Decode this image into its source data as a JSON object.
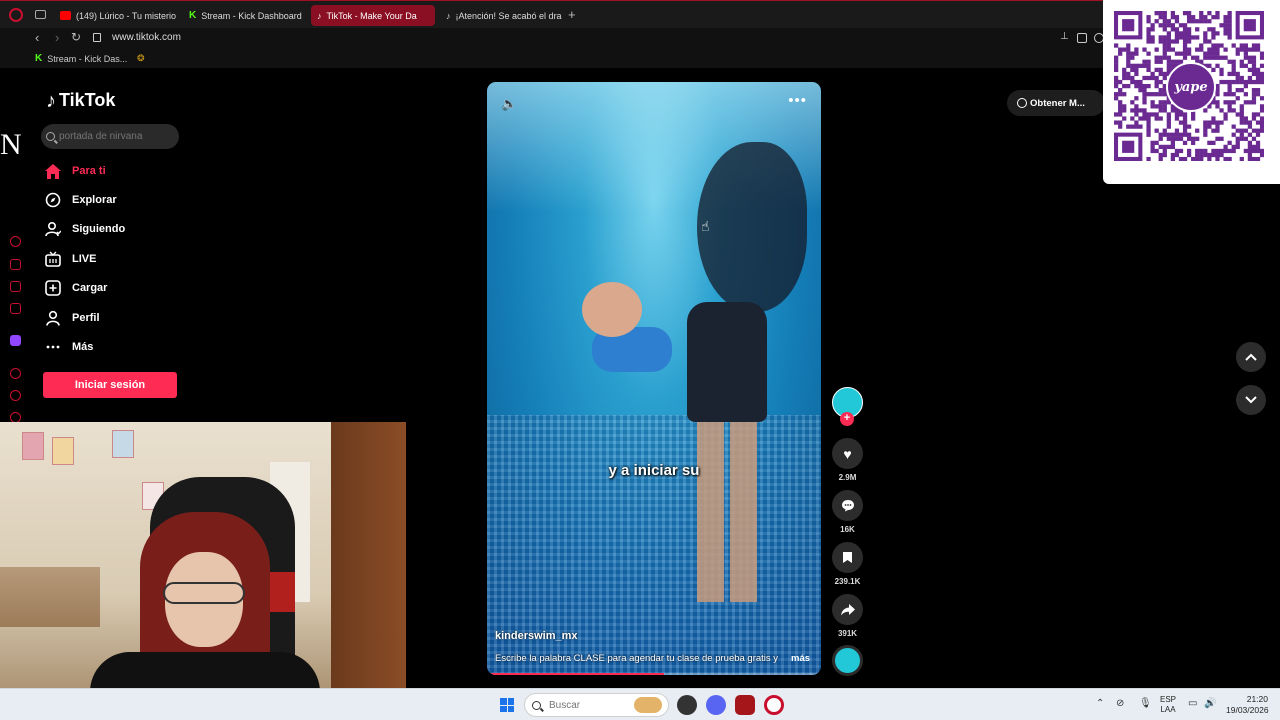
{
  "browser": {
    "tabs": [
      {
        "label": "(149) Lúrico - Tu misterios",
        "favicon_color": "#ff0000"
      },
      {
        "label": "Stream - Kick Dashboard",
        "favicon_color": "#53fc18"
      },
      {
        "label": "TikTok - Make Your Da",
        "favicon_color": "#ffffff"
      },
      {
        "label": "¡Atención! Se acabó el dra",
        "favicon_color": "#ffffff"
      }
    ],
    "active_tab_index": 2,
    "url": "www.tiktok.com",
    "bookmarks": [
      {
        "label": "Stream - Kick Das..."
      }
    ]
  },
  "tiktok": {
    "logo_text": "TikTok",
    "search": {
      "placeholder": "portada de nirvana"
    },
    "nav": [
      {
        "label": "Para ti",
        "icon": "home-icon",
        "active": true
      },
      {
        "label": "Explorar",
        "icon": "compass-icon",
        "active": false
      },
      {
        "label": "Siguiendo",
        "icon": "user-follow-icon",
        "active": false
      },
      {
        "label": "LIVE",
        "icon": "live-tv-icon",
        "active": false
      },
      {
        "label": "Cargar",
        "icon": "upload-plus-icon",
        "active": false
      },
      {
        "label": "Perfil",
        "icon": "profile-icon",
        "active": false
      },
      {
        "label": "Más",
        "icon": "more-dots-icon",
        "active": false
      }
    ],
    "login_label": "Iniciar sesión",
    "get_app_label": "Obtener M...",
    "accent_color": "#fe2c55"
  },
  "video": {
    "subtitle": "y a iniciar su",
    "author": "kinderswim_mx",
    "description": "Escribe la palabra CLASE para agendar tu clase de prueba gratis y",
    "more_label": "más",
    "progress": 0.53
  },
  "actions": {
    "likes": "2.9M",
    "comments": "16K",
    "saves": "239.1K",
    "shares": "391K"
  },
  "overlay": {
    "side_letter": "N",
    "qr_badge_text": "yape",
    "qr_badge_color": "#6b2a92"
  },
  "taskbar": {
    "search_label": "Buscar",
    "lang_line1": "ESP",
    "lang_line2": "LAA",
    "time": "21:20",
    "date": "19/03/2026"
  }
}
